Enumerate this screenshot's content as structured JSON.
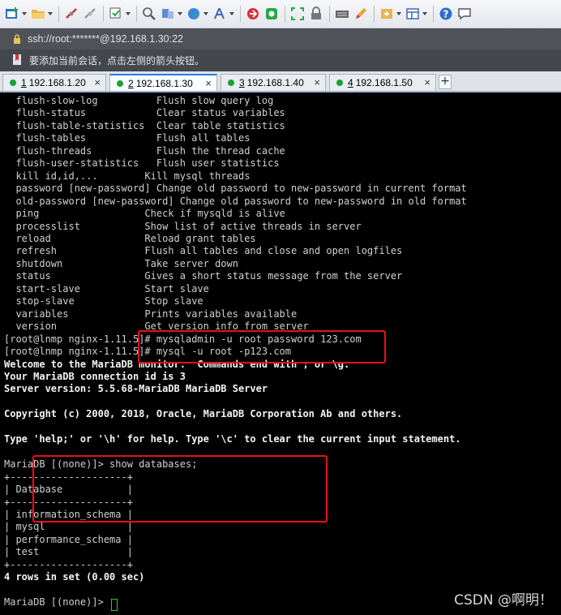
{
  "address": {
    "text": "ssh://root:*******@192.168.1.30:22"
  },
  "hint": {
    "text": "要添加当前会话，点击左侧的箭头按钮。"
  },
  "tabs": [
    {
      "num": "1",
      "label": "192.168.1.20",
      "active": false
    },
    {
      "num": "2",
      "label": "192.168.1.30",
      "active": true
    },
    {
      "num": "3",
      "label": "192.168.1.40",
      "active": false
    },
    {
      "num": "4",
      "label": "192.168.1.50",
      "active": false
    }
  ],
  "tab_close_glyph": "×",
  "tab_add_glyph": "+",
  "terminal": {
    "lines": [
      {
        "t": "  flush-slow-log          Flush slow query log"
      },
      {
        "t": "  flush-status            Clear status variables"
      },
      {
        "t": "  flush-table-statistics  Clear table statistics"
      },
      {
        "t": "  flush-tables            Flush all tables"
      },
      {
        "t": "  flush-threads           Flush the thread cache"
      },
      {
        "t": "  flush-user-statistics   Flush user statistics"
      },
      {
        "t": "  kill id,id,...        Kill mysql threads"
      },
      {
        "t": "  password [new-password] Change old password to new-password in current format"
      },
      {
        "t": "  old-password [new-password] Change old password to new-password in old format"
      },
      {
        "t": "  ping                  Check if mysqld is alive"
      },
      {
        "t": "  processlist           Show list of active threads in server"
      },
      {
        "t": "  reload                Reload grant tables"
      },
      {
        "t": "  refresh               Flush all tables and close and open logfiles"
      },
      {
        "t": "  shutdown              Take server down"
      },
      {
        "t": "  status                Gives a short status message from the server"
      },
      {
        "t": "  start-slave           Start slave"
      },
      {
        "t": "  stop-slave            Stop slave"
      },
      {
        "t": "  variables             Prints variables available"
      },
      {
        "t": "  version               Get version info from server"
      },
      {
        "t": "[root@lnmp nginx-1.11.5]# mysqladmin -u root password 123.com"
      },
      {
        "t": "[root@lnmp nginx-1.11.5]# mysql -u root -p123.com"
      },
      {
        "t": "Welcome to the MariaDB monitor.  Commands end with ; or \\g.",
        "bold": true
      },
      {
        "t": "Your MariaDB connection id is 3",
        "bold": true
      },
      {
        "t": "Server version: 5.5.68-MariaDB MariaDB Server",
        "bold": true
      },
      {
        "t": ""
      },
      {
        "t": "Copyright (c) 2000, 2018, Oracle, MariaDB Corporation Ab and others.",
        "bold": true
      },
      {
        "t": ""
      },
      {
        "t": "Type 'help;' or '\\h' for help. Type '\\c' to clear the current input statement.",
        "bold": true
      },
      {
        "t": ""
      },
      {
        "t": "MariaDB [(none)]> show databases;"
      },
      {
        "t": "+--------------------+"
      },
      {
        "t": "| Database           |"
      },
      {
        "t": "+--------------------+"
      },
      {
        "t": "| information_schema |"
      },
      {
        "t": "| mysql              |"
      },
      {
        "t": "| performance_schema |"
      },
      {
        "t": "| test               |"
      },
      {
        "t": "+--------------------+"
      },
      {
        "t": "4 rows in set (0.00 sec)",
        "bold": true
      },
      {
        "t": ""
      },
      {
        "t": "MariaDB [(none)]> "
      }
    ]
  },
  "watermark": "CSDN @啊明！",
  "colors": {
    "highlight": "#e8101a",
    "cursor": "#29d329",
    "active_tab": "#2d7de0",
    "session_dot": "#15a335"
  }
}
